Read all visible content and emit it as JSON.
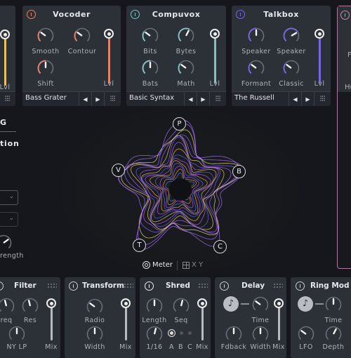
{
  "colors": {
    "background": "#15171c",
    "panel": "#2c3037",
    "vocoder": "#e0836c",
    "compuvox": "#7ec3c2",
    "talkbox": "#7766dd",
    "left_module": "#e8c05c",
    "right_module": "#c88cb0"
  },
  "left_module": {
    "slider_label": "Lvl",
    "level": 1.0,
    "mixer_icon": "sliders-icon"
  },
  "vocoder": {
    "title": "Vocoder",
    "knobs": [
      {
        "label": "Smooth",
        "value": 0.3
      },
      {
        "label": "Contour",
        "value": 0.3
      },
      {
        "label": "Shift",
        "value": 0.5
      }
    ],
    "slider_label": "Lvl",
    "level": 1.0,
    "preset": "Bass Grater",
    "prev": "◀",
    "next": "▶"
  },
  "compuvox": {
    "title": "Compuvox",
    "knobs": [
      {
        "label": "Bits",
        "value": 0.3
      },
      {
        "label": "Bytes",
        "value": 0.6
      },
      {
        "label": "Bats",
        "value": 0.5
      },
      {
        "label": "Math",
        "value": 0.3
      }
    ],
    "slider_label": "Lvl",
    "level": 1.0,
    "preset": "Basic Syntax",
    "prev": "◀",
    "next": "▶"
  },
  "talkbox": {
    "title": "Talkbox",
    "knobs": [
      {
        "label": "Speaker",
        "value": 0.5
      },
      {
        "label": "Speaker",
        "value": 0.72
      },
      {
        "label": "Formant",
        "value": 0.3
      },
      {
        "label": "Classic",
        "value": 0.3
      }
    ],
    "slider_label": "Lvl",
    "level": 1.0,
    "preset": "The Russell",
    "prev": "◀",
    "next": "▶"
  },
  "right_module": {
    "label1": "F",
    "label2": "Hu"
  },
  "side": {
    "heading": "G",
    "subheading": "tion",
    "knob_label": "rength",
    "knob_value": 0.7
  },
  "visualizer": {
    "nodes": [
      "P",
      "B",
      "C",
      "T",
      "V"
    ],
    "meter_label": "Meter",
    "xy_label": "X Y",
    "meter_icon": "meter-rings-icon",
    "xy_icon": "grid-icon"
  },
  "filter": {
    "title": "Filter",
    "knobs": [
      {
        "label": "req",
        "value": 0.45
      },
      {
        "label": "Res",
        "value": 0.45
      },
      {
        "label": "NY LP",
        "value": 0.5
      }
    ],
    "slider_label": "Mix",
    "level": 1.0
  },
  "transform": {
    "title": "Transform",
    "knobs": [
      {
        "label": "Radio",
        "value": 0.3
      },
      {
        "label": "Width",
        "value": 0.5
      }
    ],
    "slider_label": "Mix",
    "level": 1.0
  },
  "shred": {
    "title": "Shred",
    "knobs": [
      {
        "label": "Length",
        "value": 0.5
      },
      {
        "label": "Seq",
        "value": 0.55
      },
      {
        "label": "1/16",
        "value": 0.55
      }
    ],
    "patterns": [
      "A",
      "B",
      "C"
    ],
    "selected_pattern": "A",
    "slider_label": "Mix",
    "level": 1.0
  },
  "delay": {
    "title": "Delay",
    "sync": "♪",
    "knobs": [
      {
        "label": "Time",
        "value": 0.3
      },
      {
        "label": "Fdback",
        "value": 0.5
      },
      {
        "label": "Width",
        "value": 0.5
      }
    ],
    "slider_label": "Mix",
    "level": 1.0
  },
  "ringmod": {
    "title": "Ring Mod",
    "sync": "♪",
    "knobs": [
      {
        "label": "Time",
        "value": 0.5
      },
      {
        "label": "LFO",
        "value": 0.3
      },
      {
        "label": "Depth",
        "value": 0.6
      }
    ]
  }
}
